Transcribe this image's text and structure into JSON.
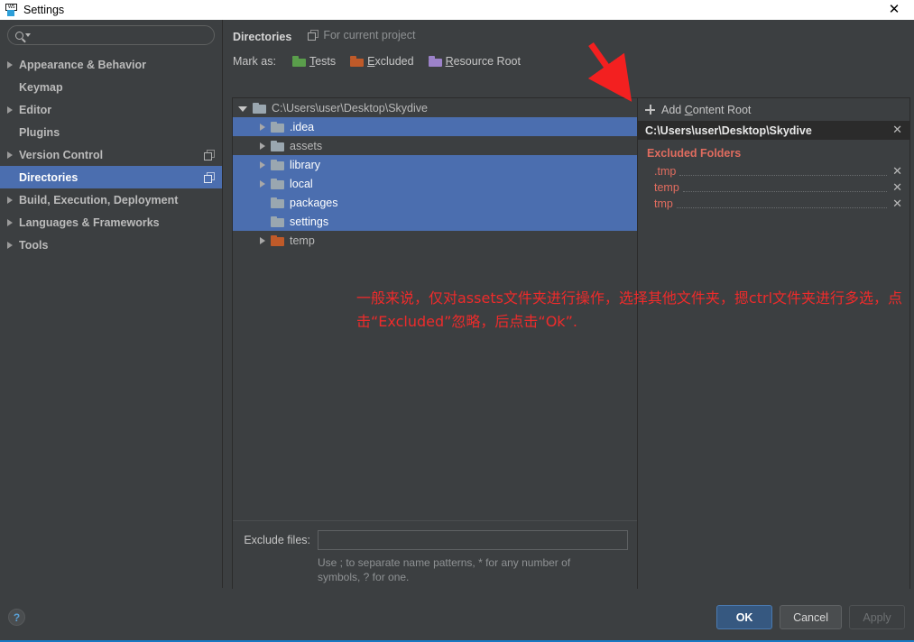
{
  "window": {
    "title": "Settings",
    "app_icon": "webstorm-icon",
    "close_label": "✕"
  },
  "sidebar": {
    "search": {
      "value": "",
      "placeholder": ""
    },
    "items": [
      {
        "label": "Appearance & Behavior",
        "expandable": true,
        "selected": false,
        "config_icon": false
      },
      {
        "label": "Keymap",
        "expandable": false,
        "selected": false,
        "config_icon": false
      },
      {
        "label": "Editor",
        "expandable": true,
        "selected": false,
        "config_icon": false
      },
      {
        "label": "Plugins",
        "expandable": false,
        "selected": false,
        "config_icon": false
      },
      {
        "label": "Version Control",
        "expandable": true,
        "selected": false,
        "config_icon": true
      },
      {
        "label": "Directories",
        "expandable": false,
        "selected": true,
        "config_icon": true
      },
      {
        "label": "Build, Execution, Deployment",
        "expandable": true,
        "selected": false,
        "config_icon": false
      },
      {
        "label": "Languages & Frameworks",
        "expandable": true,
        "selected": false,
        "config_icon": false
      },
      {
        "label": "Tools",
        "expandable": true,
        "selected": false,
        "config_icon": false
      }
    ]
  },
  "main": {
    "title": "Directories",
    "scope_label": "For current project",
    "mark_as_label": "Mark as:",
    "mark_buttons": [
      {
        "label": "Tests",
        "accel": "T",
        "rest": "ests",
        "color": "#5a9e4b",
        "swatch": "green"
      },
      {
        "label": "Excluded",
        "accel": "E",
        "rest": "xcluded",
        "color": "#bf5a29",
        "swatch": "orange"
      },
      {
        "label": "Resource Root",
        "accel": "R",
        "rest": "esource Root",
        "color": "#9c82c9",
        "swatch": "purple"
      }
    ],
    "tree": [
      {
        "name": "C:\\Users\\user\\Desktop\\Skydive",
        "indent": 0,
        "twisty": "open",
        "folder": "grey",
        "selected": false
      },
      {
        "name": ".idea",
        "indent": 1,
        "twisty": "closed",
        "folder": "grey",
        "selected": true
      },
      {
        "name": "assets",
        "indent": 1,
        "twisty": "closed",
        "folder": "grey",
        "selected": false
      },
      {
        "name": "library",
        "indent": 1,
        "twisty": "closed",
        "folder": "grey",
        "selected": true
      },
      {
        "name": "local",
        "indent": 1,
        "twisty": "closed",
        "folder": "grey",
        "selected": true
      },
      {
        "name": "packages",
        "indent": 1,
        "twisty": "none",
        "folder": "grey",
        "selected": true
      },
      {
        "name": "settings",
        "indent": 1,
        "twisty": "none",
        "folder": "grey",
        "selected": true
      },
      {
        "name": "temp",
        "indent": 1,
        "twisty": "closed",
        "folder": "orange",
        "selected": false
      }
    ],
    "exclude_files": {
      "label": "Exclude files:",
      "value": "",
      "placeholder": "",
      "hint": "Use ; to separate name patterns, * for any number of symbols, ? for one."
    }
  },
  "right_pane": {
    "add_content_root": {
      "prefix": "Add ",
      "accel": "C",
      "rest": "ontent Root"
    },
    "content_root": {
      "path": "C:\\Users\\user\\Desktop\\Skydive",
      "remove": "✕"
    },
    "excluded_title": "Excluded Folders",
    "excluded_folders": [
      {
        "name": ".tmp",
        "remove": "✕"
      },
      {
        "name": "temp",
        "remove": "✕"
      },
      {
        "name": "tmp",
        "remove": "✕"
      }
    ]
  },
  "annotation": {
    "text": "一般来说，仅对assets文件夹进行操作，选择其他文件夹，摁ctrl文件夹进行多选，点击“Excluded”忽略，后点击“Ok”.",
    "color": "#ee2b2b",
    "arrow_color": "#f32020"
  },
  "footer": {
    "help": "?",
    "buttons": [
      {
        "label": "OK",
        "style": "primary"
      },
      {
        "label": "Cancel",
        "style": "normal"
      },
      {
        "label": "Apply",
        "style": "disabled"
      }
    ],
    "accent_color": "#1879c4"
  }
}
